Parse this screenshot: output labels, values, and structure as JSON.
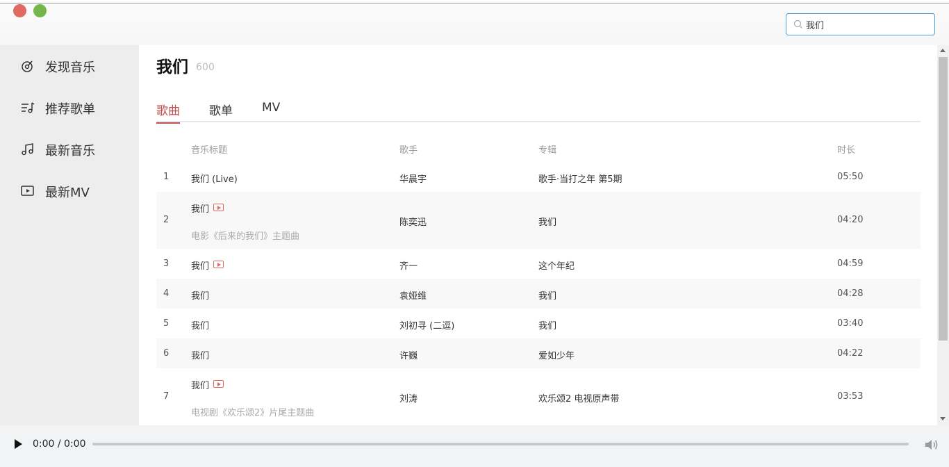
{
  "window": {
    "close_color": "#e06a62",
    "maximize_color": "#74b64c"
  },
  "search": {
    "value": "我们",
    "icon": "search-icon"
  },
  "sidebar": {
    "items": [
      {
        "label": "发现音乐",
        "icon": "discover-music-icon"
      },
      {
        "label": "推荐歌单",
        "icon": "playlist-icon"
      },
      {
        "label": "最新音乐",
        "icon": "music-note-icon"
      },
      {
        "label": "最新MV",
        "icon": "video-icon"
      }
    ]
  },
  "main": {
    "title": "我们",
    "count": "600",
    "tabs": [
      {
        "label": "歌曲",
        "active": true
      },
      {
        "label": "歌单",
        "active": false
      },
      {
        "label": "MV",
        "active": false
      }
    ],
    "accent_color": "#c0504d",
    "table": {
      "headers": {
        "title": "音乐标题",
        "singer": "歌手",
        "album": "专辑",
        "duration": "时长"
      },
      "rows": [
        {
          "index": "1",
          "title": "我们 (Live)",
          "subtitle": "",
          "mv": false,
          "singer": "华晨宇",
          "album": "歌手·当打之年 第5期",
          "duration": "05:50"
        },
        {
          "index": "2",
          "title": "我们",
          "subtitle": "电影《后来的我们》主题曲",
          "mv": true,
          "singer": "陈奕迅",
          "album": "我们",
          "duration": "04:20"
        },
        {
          "index": "3",
          "title": "我们",
          "subtitle": "",
          "mv": true,
          "singer": "齐一",
          "album": "这个年纪",
          "duration": "04:59"
        },
        {
          "index": "4",
          "title": "我们",
          "subtitle": "",
          "mv": false,
          "singer": "袁娅维",
          "album": "我们",
          "duration": "04:28"
        },
        {
          "index": "5",
          "title": "我们",
          "subtitle": "",
          "mv": false,
          "singer": "刘初寻 (二逗)",
          "album": "我们",
          "duration": "03:40"
        },
        {
          "index": "6",
          "title": "我们",
          "subtitle": "",
          "mv": false,
          "singer": "许巍",
          "album": "爱如少年",
          "duration": "04:22"
        },
        {
          "index": "7",
          "title": "我们",
          "subtitle": "电视剧《欢乐颂2》片尾主题曲",
          "mv": true,
          "singer": "刘涛",
          "album": "欢乐颂2 电视原声带",
          "duration": "03:53"
        }
      ]
    }
  },
  "player": {
    "time": "0:00 / 0:00",
    "progress": 0
  }
}
